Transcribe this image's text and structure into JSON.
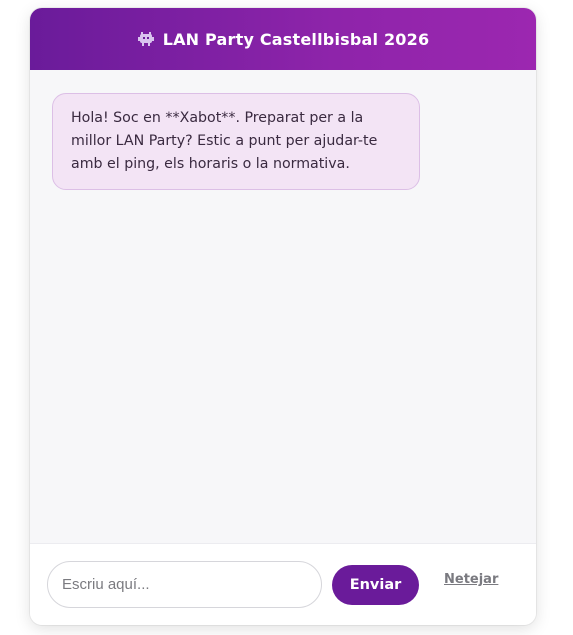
{
  "header": {
    "icon": "alien-monster-icon",
    "title": "LAN Party Castellbisbal 2026"
  },
  "messages": [
    {
      "sender": "bot",
      "text": "Hola! Soc en **Xabot**. Preparat per a la millor LAN Party? Estic a punt per ajudar-te amb el ping, els horaris o la normativa."
    }
  ],
  "composer": {
    "placeholder": "Escriu aquí...",
    "value": "",
    "send_label": "Enviar",
    "clear_label": "Netejar"
  },
  "colors": {
    "header_gradient_start": "#6a1b9a",
    "header_gradient_end": "#9c27b0",
    "bot_bubble_bg": "#f3e4f5",
    "bot_bubble_border": "#dcbfe6",
    "send_button_bg": "#6a1b9a"
  }
}
